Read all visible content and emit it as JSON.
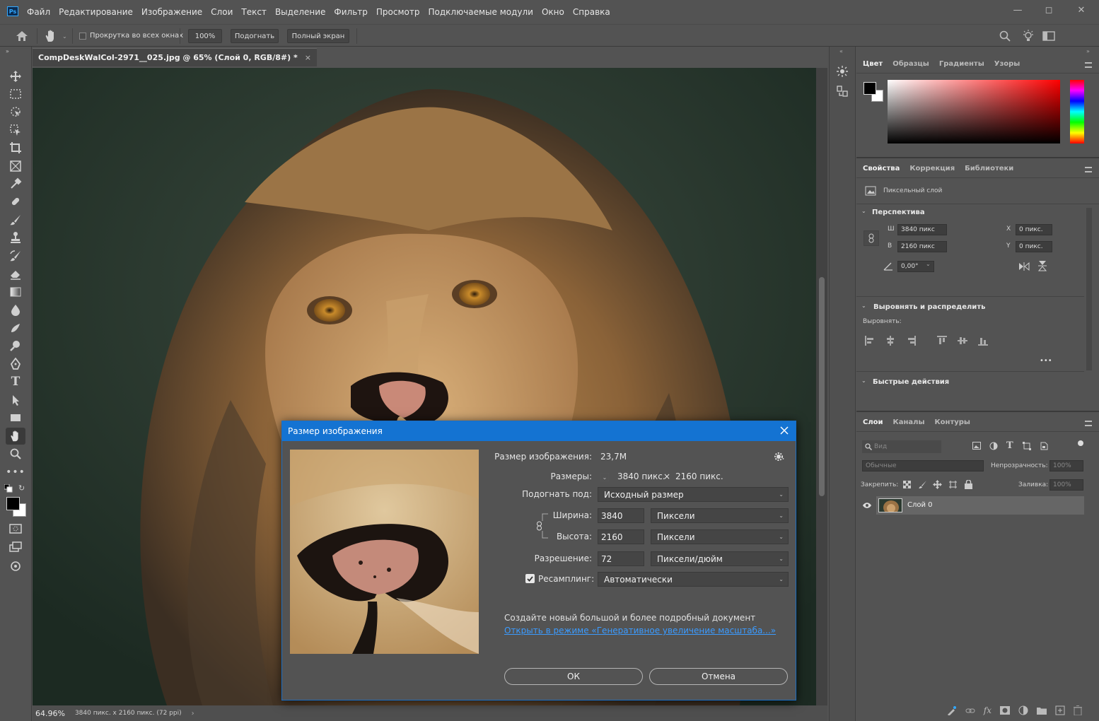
{
  "app": {
    "logo_text": "Ps",
    "menu": [
      "Файл",
      "Редактирование",
      "Изображение",
      "Слои",
      "Текст",
      "Выделение",
      "Фильтр",
      "Просмотр",
      "Подключаемые модули",
      "Окно",
      "Справка"
    ]
  },
  "options_bar": {
    "scroll_all_label": "Прокрутка во всех окнах",
    "zoom_100": "100%",
    "fit_label": "Подогнать",
    "fullscreen_label": "Полный экран"
  },
  "document": {
    "tab_title": "CompDeskWalCol-2971__025.jpg @ 65% (Слой 0, RGB/8#) *",
    "tab_close": "×",
    "zoom_status": "64.96%",
    "size_status": "3840 пикс. x 2160 пикс. (72 ppi)"
  },
  "color_panel": {
    "tabs": [
      "Цвет",
      "Образцы",
      "Градиенты",
      "Узоры"
    ],
    "foreground": "#000000",
    "background": "#ffffff",
    "hue": "#ff0000"
  },
  "properties_panel": {
    "tabs": [
      "Свойства",
      "Коррекция",
      "Библиотеки"
    ],
    "layer_type": "Пиксельный слой",
    "transform_section": "Перспектива",
    "w_label": "Ш",
    "w_value": "3840 пикс",
    "h_label": "В",
    "h_value": "2160 пикс",
    "x_label": "X",
    "x_value": "0 пикс.",
    "y_label": "Y",
    "y_value": "0 пикс.",
    "angle": "0,00°",
    "align_section": "Выровнять и распределить",
    "align_label": "Выровнять:",
    "more": "•••",
    "quick_section": "Быстрые действия"
  },
  "layers_panel": {
    "tabs": [
      "Слои",
      "Каналы",
      "Контуры"
    ],
    "search_placeholder": "Вид",
    "blend_mode": "Обычные",
    "opacity_label": "Непрозрачность:",
    "opacity_value": "100%",
    "lock_label": "Закрепить:",
    "fill_label": "Заливка:",
    "fill_value": "100%",
    "layers": [
      {
        "name": "Слой 0",
        "visible": true
      }
    ]
  },
  "dialog": {
    "title": "Размер изображения",
    "image_size_label": "Размер изображения:",
    "image_size_value": "23,7M",
    "dimensions_label": "Размеры:",
    "dim_w": "3840 пикс.",
    "dim_x": "×",
    "dim_h": "2160 пикс.",
    "fit_to_label": "Подогнать под:",
    "fit_to_value": "Исходный размер",
    "width_label": "Ширина:",
    "width_value": "3840",
    "width_unit": "Пиксели",
    "height_label": "Высота:",
    "height_value": "2160",
    "height_unit": "Пиксели",
    "resolution_label": "Разрешение:",
    "resolution_value": "72",
    "resolution_unit": "Пиксели/дюйм",
    "resample_label": "Ресамплинг:",
    "resample_checked": true,
    "resample_value": "Автоматически",
    "promo_text": "Создайте новый большой и более подробный документ",
    "promo_link": "Открыть в режиме «Генеративное увеличение масштаба...»",
    "ok_label": "ОК",
    "cancel_label": "Отмена"
  }
}
